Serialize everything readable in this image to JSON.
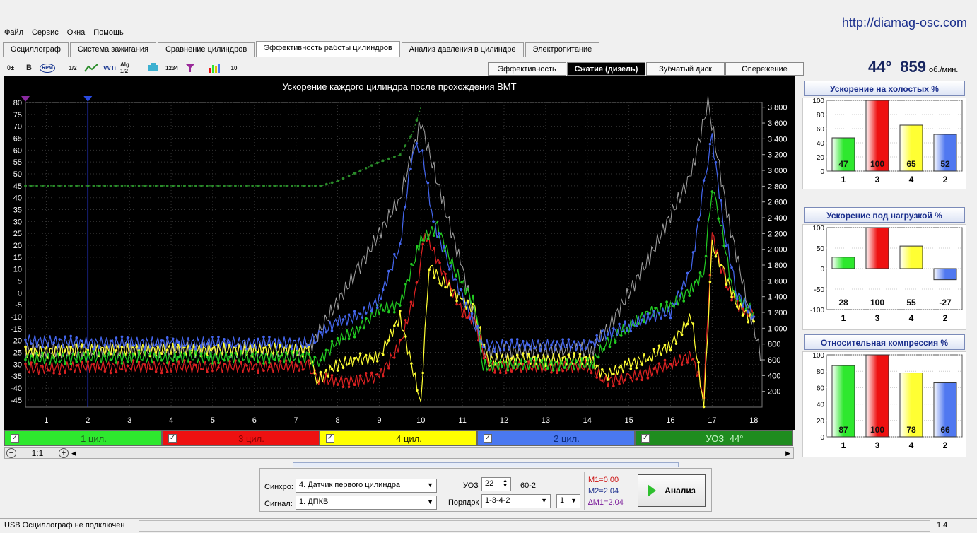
{
  "url": "http://diamag-osc.com",
  "menu": [
    "Файл",
    "Сервис",
    "Окна",
    "Помощь"
  ],
  "tabs": [
    {
      "label": "Осциллограф",
      "active": false
    },
    {
      "label": "Система зажигания",
      "active": false
    },
    {
      "label": "Сравнение цилиндров",
      "active": false
    },
    {
      "label": "Эффективность работы цилиндров",
      "active": true
    },
    {
      "label": "Анализ давления в цилиндре",
      "active": false
    },
    {
      "label": "Электропитание",
      "active": false
    }
  ],
  "toolbar": [
    "0±",
    "B",
    "RPM",
    "1/2",
    "~",
    "VVTi",
    "Alg 1/2",
    "",
    "1234",
    "",
    "",
    "10"
  ],
  "subtabs": [
    {
      "label": "Эффективность",
      "active": false
    },
    {
      "label": "Сжатие (дизель)",
      "active": true
    },
    {
      "label": "Зубчатый диск",
      "active": false
    },
    {
      "label": "Опережение",
      "active": false
    }
  ],
  "readout": {
    "angle": "44°",
    "rpm": "859",
    "unit": "об./мин."
  },
  "chart_data": {
    "type": "line",
    "title": "Ускорение каждого цилиндра после прохождения ВМТ",
    "x_ticks": [
      "1",
      "2",
      "3",
      "4",
      "5",
      "6",
      "7",
      "8",
      "9",
      "10",
      "11",
      "12",
      "13",
      "14",
      "15",
      "16",
      "17",
      "18"
    ],
    "xlim": [
      0.5,
      18.2
    ],
    "y_left_ticks": [
      "80",
      "75",
      "70",
      "65",
      "60",
      "55",
      "50",
      "45",
      "40",
      "35",
      "30",
      "25",
      "20",
      "15",
      "10",
      "5",
      "0",
      "-5",
      "-10",
      "-15",
      "-20",
      "-25",
      "-30",
      "-35",
      "-40",
      "-45"
    ],
    "ylim_left": [
      -48,
      80
    ],
    "y_right_ticks": [
      "3 800",
      "3 600",
      "3 400",
      "3 200",
      "3 000",
      "2 800",
      "2 600",
      "2 400",
      "2 200",
      "2 000",
      "1 800",
      "1 600",
      "1 400",
      "1 200",
      "1 000",
      "800",
      "600",
      "400",
      "200"
    ],
    "ylim_right": [
      0,
      3860
    ],
    "cursor_x": 2,
    "series": [
      {
        "name": "1 цил.",
        "color": "#22cc22",
        "points": [
          [
            0.5,
            -28
          ],
          [
            2,
            -27
          ],
          [
            3,
            -27
          ],
          [
            4,
            -27
          ],
          [
            5,
            -27
          ],
          [
            6,
            -27
          ],
          [
            7.3,
            -27
          ],
          [
            7.5,
            -30
          ],
          [
            8,
            -20
          ],
          [
            8.5,
            -15
          ],
          [
            9,
            -7
          ],
          [
            9.5,
            -5
          ],
          [
            10,
            22
          ],
          [
            10.4,
            28
          ],
          [
            10.8,
            10
          ],
          [
            11.3,
            -5
          ],
          [
            11.5,
            -31
          ],
          [
            12,
            -30
          ],
          [
            13,
            -30
          ],
          [
            14.1,
            -30
          ],
          [
            14.4,
            -22
          ],
          [
            15,
            -14
          ],
          [
            15.5,
            -8
          ],
          [
            16,
            -6
          ],
          [
            16.5,
            2
          ],
          [
            16.8,
            8
          ],
          [
            17,
            45
          ],
          [
            17.2,
            30
          ],
          [
            17.5,
            0
          ],
          [
            18,
            -8
          ]
        ]
      },
      {
        "name": "3 цил.",
        "color": "#dd2222",
        "points": [
          [
            0.5,
            -32
          ],
          [
            2,
            -31
          ],
          [
            3,
            -31
          ],
          [
            4,
            -31
          ],
          [
            5,
            -31
          ],
          [
            6,
            -31
          ],
          [
            7.3,
            -31
          ],
          [
            7.5,
            -36
          ],
          [
            8,
            -37
          ],
          [
            8.5,
            -37
          ],
          [
            9,
            -35
          ],
          [
            9.5,
            -22
          ],
          [
            9.9,
            2
          ],
          [
            10.1,
            25
          ],
          [
            10.5,
            10
          ],
          [
            11,
            -8
          ],
          [
            11.3,
            -12
          ],
          [
            11.6,
            -31
          ],
          [
            12,
            -31
          ],
          [
            13,
            -31
          ],
          [
            14.1,
            -31
          ],
          [
            14.4,
            -37
          ],
          [
            15,
            -36
          ],
          [
            15.5,
            -33
          ],
          [
            16,
            -30
          ],
          [
            16.5,
            -26
          ],
          [
            16.8,
            -42
          ],
          [
            17,
            25
          ],
          [
            17.3,
            5
          ],
          [
            17.6,
            -5
          ],
          [
            18,
            -10
          ]
        ]
      },
      {
        "name": "4 цил.",
        "color": "#ffff33",
        "points": [
          [
            0.5,
            -25
          ],
          [
            2,
            -24
          ],
          [
            3,
            -24
          ],
          [
            4,
            -24
          ],
          [
            5,
            -24
          ],
          [
            6,
            -24
          ],
          [
            7.3,
            -24
          ],
          [
            7.5,
            -37
          ],
          [
            8,
            -30
          ],
          [
            8.5,
            -28
          ],
          [
            9,
            -27
          ],
          [
            9.5,
            -10
          ],
          [
            10,
            -46
          ],
          [
            10.2,
            12
          ],
          [
            10.5,
            5
          ],
          [
            11,
            -3
          ],
          [
            11.3,
            -8
          ],
          [
            11.6,
            -28
          ],
          [
            12,
            -28
          ],
          [
            13,
            -28
          ],
          [
            14.1,
            -28
          ],
          [
            14.4,
            -35
          ],
          [
            15,
            -30
          ],
          [
            15.5,
            -27
          ],
          [
            16,
            -22
          ],
          [
            16.5,
            -10
          ],
          [
            16.8,
            -48
          ],
          [
            17,
            20
          ],
          [
            17.3,
            8
          ],
          [
            17.6,
            -5
          ],
          [
            18,
            -12
          ]
        ]
      },
      {
        "name": "2 цил.",
        "color": "#4466ee",
        "points": [
          [
            0.5,
            -20
          ],
          [
            2,
            -21
          ],
          [
            3,
            -21
          ],
          [
            4,
            -21
          ],
          [
            5,
            -21
          ],
          [
            6,
            -21
          ],
          [
            7.3,
            -21
          ],
          [
            7.5,
            -18
          ],
          [
            8,
            -12
          ],
          [
            8.5,
            -10
          ],
          [
            9,
            -3
          ],
          [
            9.5,
            20
          ],
          [
            9.8,
            60
          ],
          [
            10,
            62
          ],
          [
            10.3,
            30
          ],
          [
            10.6,
            15
          ],
          [
            11,
            -2
          ],
          [
            11.5,
            -22
          ],
          [
            12,
            -22
          ],
          [
            13,
            -22
          ],
          [
            14.1,
            -22
          ],
          [
            14.4,
            -18
          ],
          [
            15,
            -14
          ],
          [
            15.5,
            -10
          ],
          [
            16,
            -8
          ],
          [
            16.5,
            10
          ],
          [
            16.8,
            45
          ],
          [
            17,
            65
          ],
          [
            17.3,
            25
          ],
          [
            17.6,
            0
          ],
          [
            18,
            -10
          ]
        ]
      },
      {
        "name": "УОЗ=44°",
        "color": "#2a8c2a",
        "points": [
          [
            0.5,
            45
          ],
          [
            2,
            45
          ],
          [
            3,
            45
          ],
          [
            4,
            45
          ],
          [
            5,
            45
          ],
          [
            6,
            45
          ],
          [
            7,
            45
          ],
          [
            7.6,
            45
          ],
          [
            8,
            47
          ],
          [
            8.5,
            51
          ],
          [
            9,
            55
          ],
          [
            9.5,
            58
          ],
          [
            9.8,
            67
          ],
          [
            10,
            78
          ]
        ]
      },
      {
        "name": "",
        "color": "#a0a0a0",
        "points": [
          [
            0.5,
            -24
          ],
          [
            7.3,
            -24
          ],
          [
            7.7,
            -12
          ],
          [
            8.5,
            10
          ],
          [
            9.5,
            40
          ],
          [
            10,
            72
          ],
          [
            10.5,
            40
          ],
          [
            11,
            10
          ],
          [
            11.5,
            -25
          ],
          [
            14.1,
            -24
          ],
          [
            14.5,
            -15
          ],
          [
            15.5,
            15
          ],
          [
            16.5,
            50
          ],
          [
            16.9,
            80
          ],
          [
            17.4,
            30
          ],
          [
            17.9,
            -8
          ],
          [
            18.2,
            -28
          ]
        ]
      }
    ]
  },
  "legend": [
    {
      "label": "1 цил.",
      "bg": "#2ee82e",
      "fg": "#1c5c1c"
    },
    {
      "label": "3 цил.",
      "bg": "#ee1111",
      "fg": "#8a0000"
    },
    {
      "label": "4 цил.",
      "bg": "#ffff00",
      "fg": "#222200"
    },
    {
      "label": "2 цил.",
      "bg": "#4a78f0",
      "fg": "#0b2a7a"
    },
    {
      "label": "УОЗ=44°",
      "bg": "#1f8c1f",
      "fg": "#c8f5c8"
    }
  ],
  "zoom_label": "1:1",
  "panels": [
    {
      "title": "Ускорение на холостых %",
      "ylim": [
        0,
        100
      ],
      "ticks": [
        "100",
        "80",
        "60",
        "40",
        "20",
        "0"
      ],
      "bars": [
        {
          "cat": "1",
          "value": 47,
          "color": "#2ee82e"
        },
        {
          "cat": "3",
          "value": 100,
          "color": "#ee1111"
        },
        {
          "cat": "4",
          "value": 65,
          "color": "#ffff33"
        },
        {
          "cat": "2",
          "value": 52,
          "color": "#5078f0"
        }
      ]
    },
    {
      "title": "Ускорение под нагрузкой %",
      "ylim": [
        -100,
        100
      ],
      "ticks": [
        "100",
        "50",
        "0",
        "-50",
        "-100"
      ],
      "bars": [
        {
          "cat": "1",
          "value": 28,
          "color": "#2ee82e"
        },
        {
          "cat": "3",
          "value": 100,
          "color": "#ee1111"
        },
        {
          "cat": "4",
          "value": 55,
          "color": "#ffff33"
        },
        {
          "cat": "2",
          "value": -27,
          "color": "#5078f0"
        }
      ]
    },
    {
      "title": "Относительная компрессия %",
      "ylim": [
        0,
        100
      ],
      "ticks": [
        "100",
        "80",
        "60",
        "40",
        "20",
        "0"
      ],
      "bars": [
        {
          "cat": "1",
          "value": 87,
          "color": "#2ee82e"
        },
        {
          "cat": "3",
          "value": 100,
          "color": "#ee1111"
        },
        {
          "cat": "4",
          "value": 78,
          "color": "#ffff33"
        },
        {
          "cat": "2",
          "value": 66,
          "color": "#5078f0"
        }
      ]
    }
  ],
  "controls": {
    "sync_label": "Синхро:",
    "sync_value": "4.  Датчик первого цилиндра",
    "signal_label": "Сигнал:",
    "signal_value": "1.  ДПКВ",
    "uoz_label": "УОЗ",
    "uoz_value": "22",
    "teeth": "60-2",
    "order_label": "Порядок",
    "order_value": "1-3-4-2",
    "order_num": "1",
    "m1": "M1=0.00",
    "m2": "M2=2.04",
    "dm1": "∆M1=2.04",
    "analyze": "Анализ"
  },
  "status": {
    "left": "USB Осциллограф не подключен",
    "right": "1.4"
  }
}
